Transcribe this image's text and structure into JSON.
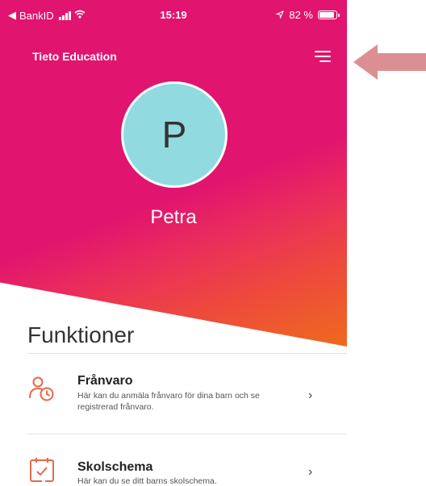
{
  "status_bar": {
    "back_app": "BankID",
    "time": "15:19",
    "battery": "82 %",
    "battery_level": 0.82
  },
  "header": {
    "app_title": "Tieto Education",
    "menu_icon": "hamburger-menu-icon"
  },
  "profile": {
    "initial": "P",
    "name": "Petra",
    "avatar_color": "#91dbe0"
  },
  "functions": {
    "title": "Funktioner",
    "items": [
      {
        "title": "Frånvaro",
        "description": "Här kan du anmäla frånvaro för dina barn och se registrerad frånvaro.",
        "icon": "person-clock-icon"
      },
      {
        "title": "Skolschema",
        "description": "Här kan du se ditt barns skolschema.",
        "icon": "calendar-check-icon"
      }
    ]
  },
  "colors": {
    "brand_pink": "#e1146f",
    "brand_orange": "#ee6a1e",
    "icon_orange": "#e8684a",
    "annotation_arrow": "#dc8f93"
  }
}
